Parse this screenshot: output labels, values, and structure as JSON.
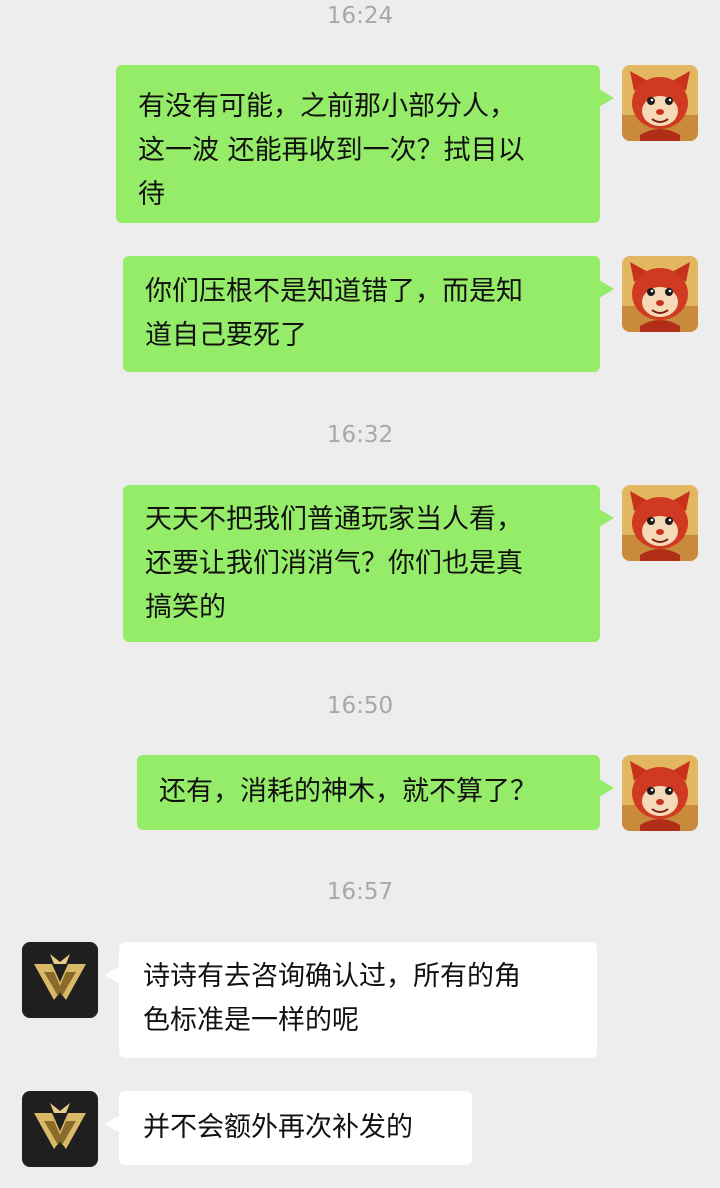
{
  "timestamps": [
    "16:24",
    "16:32",
    "16:50",
    "16:57"
  ],
  "messages": [
    {
      "sender": "me",
      "text": "有没有可能，之前那小部分人，\n这一波 还能再收到一次？拭目以\n待"
    },
    {
      "sender": "me",
      "text": "你们压根不是知道错了，而是知\n道自己要死了"
    },
    {
      "sender": "me",
      "text": "天天不把我们普通玩家当人看，\n还要让我们消消气？你们也是真\n搞笑的"
    },
    {
      "sender": "me",
      "text": "还有，消耗的神木，就不算了？"
    },
    {
      "sender": "other",
      "text": "诗诗有去咨询确认过，所有的角\n色标准是一样的呢"
    },
    {
      "sender": "other",
      "text": "并不会额外再次补发的"
    }
  ],
  "avatars": {
    "me": "cartoon-fox-avatar",
    "other": "gold-emblem-avatar"
  },
  "colors": {
    "background": "#ededed",
    "outgoing_bubble": "#95ec69",
    "incoming_bubble": "#ffffff",
    "timestamp": "#a8a8a8"
  }
}
